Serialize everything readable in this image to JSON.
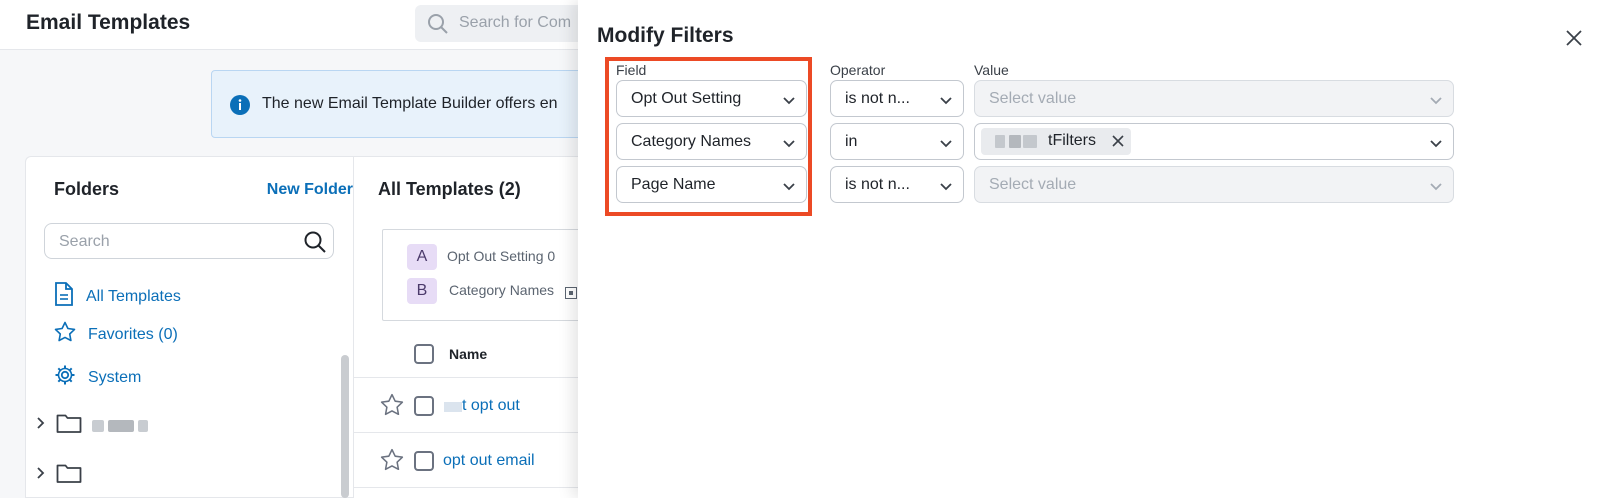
{
  "app": {
    "title": "Email Templates",
    "search_placeholder": "Search for Com"
  },
  "banner": {
    "text": "The new Email Template Builder offers en"
  },
  "folders": {
    "title": "Folders",
    "new_folder_label": "New Folder",
    "search_placeholder": "Search",
    "nav": [
      {
        "label": "All Templates"
      },
      {
        "label": "Favorites (0)"
      },
      {
        "label": "System"
      }
    ]
  },
  "templates": {
    "title": "All Templates (2)",
    "filter_chips": [
      {
        "letter": "A",
        "text": "Opt Out Setting   0"
      },
      {
        "letter": "B",
        "text": "Category Names"
      }
    ],
    "name_header": "Name",
    "rows": [
      {
        "name": "t opt out"
      },
      {
        "name": "opt out email"
      }
    ]
  },
  "modal": {
    "title": "Modify Filters",
    "column_labels": {
      "field": "Field",
      "operator": "Operator",
      "value": "Value"
    },
    "filters": [
      {
        "field": "Opt Out Setting",
        "operator": "is not n...",
        "value_placeholder": "Select value"
      },
      {
        "field": "Category Names",
        "operator": "in",
        "value_tag": "tFilters"
      },
      {
        "field": "Page Name",
        "operator": "is not n...",
        "value_placeholder": "Select value"
      }
    ]
  },
  "colors": {
    "highlight": "#ec4a25",
    "link": "#0b6fb8",
    "chip_bg": "#e7dcf6"
  }
}
